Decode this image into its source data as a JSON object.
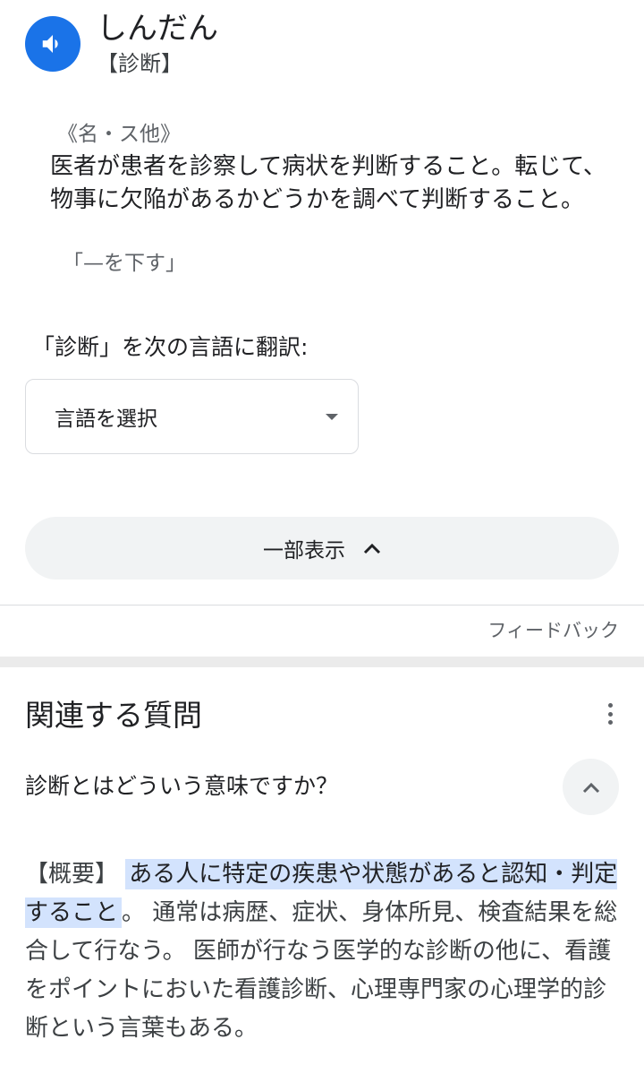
{
  "entry": {
    "reading": "しんだん",
    "kanji": "【診断】",
    "part_of_speech": "《名・ス他》",
    "definition": "医者が患者を診察して病状を判断すること。転じて、物事に欠陥があるかどうかを調べて判断すること。",
    "example": "「—を下す」"
  },
  "translate": {
    "label": "「診断」を次の言語に翻訳:",
    "select_value": "言語を選択"
  },
  "show_less": {
    "label": "一部表示"
  },
  "feedback": {
    "label": "フィードバック"
  },
  "related_questions": {
    "title": "関連する質問",
    "items": [
      {
        "question": "診断とはどういう意味ですか？",
        "answer_label": "【概要】",
        "answer_highlight": "ある人に特定の疾患や状態があると認知・判定すること",
        "answer_rest": "。 通常は病歴、症状、身体所見、検査結果を総合して行なう。 医師が行なう医学的な診断の他に、看護をポイントにおいた看護診断、心理専門家の心理学的診断という言葉もある。"
      }
    ]
  },
  "colors": {
    "accent": "#1a73e8",
    "highlight": "#d3e3fd",
    "button_bg": "#f1f3f4"
  },
  "icons": {
    "speaker": "volume-icon",
    "dropdown": "caret-down-icon",
    "chevron": "chevron-up-icon",
    "menu": "more-vert-icon"
  }
}
